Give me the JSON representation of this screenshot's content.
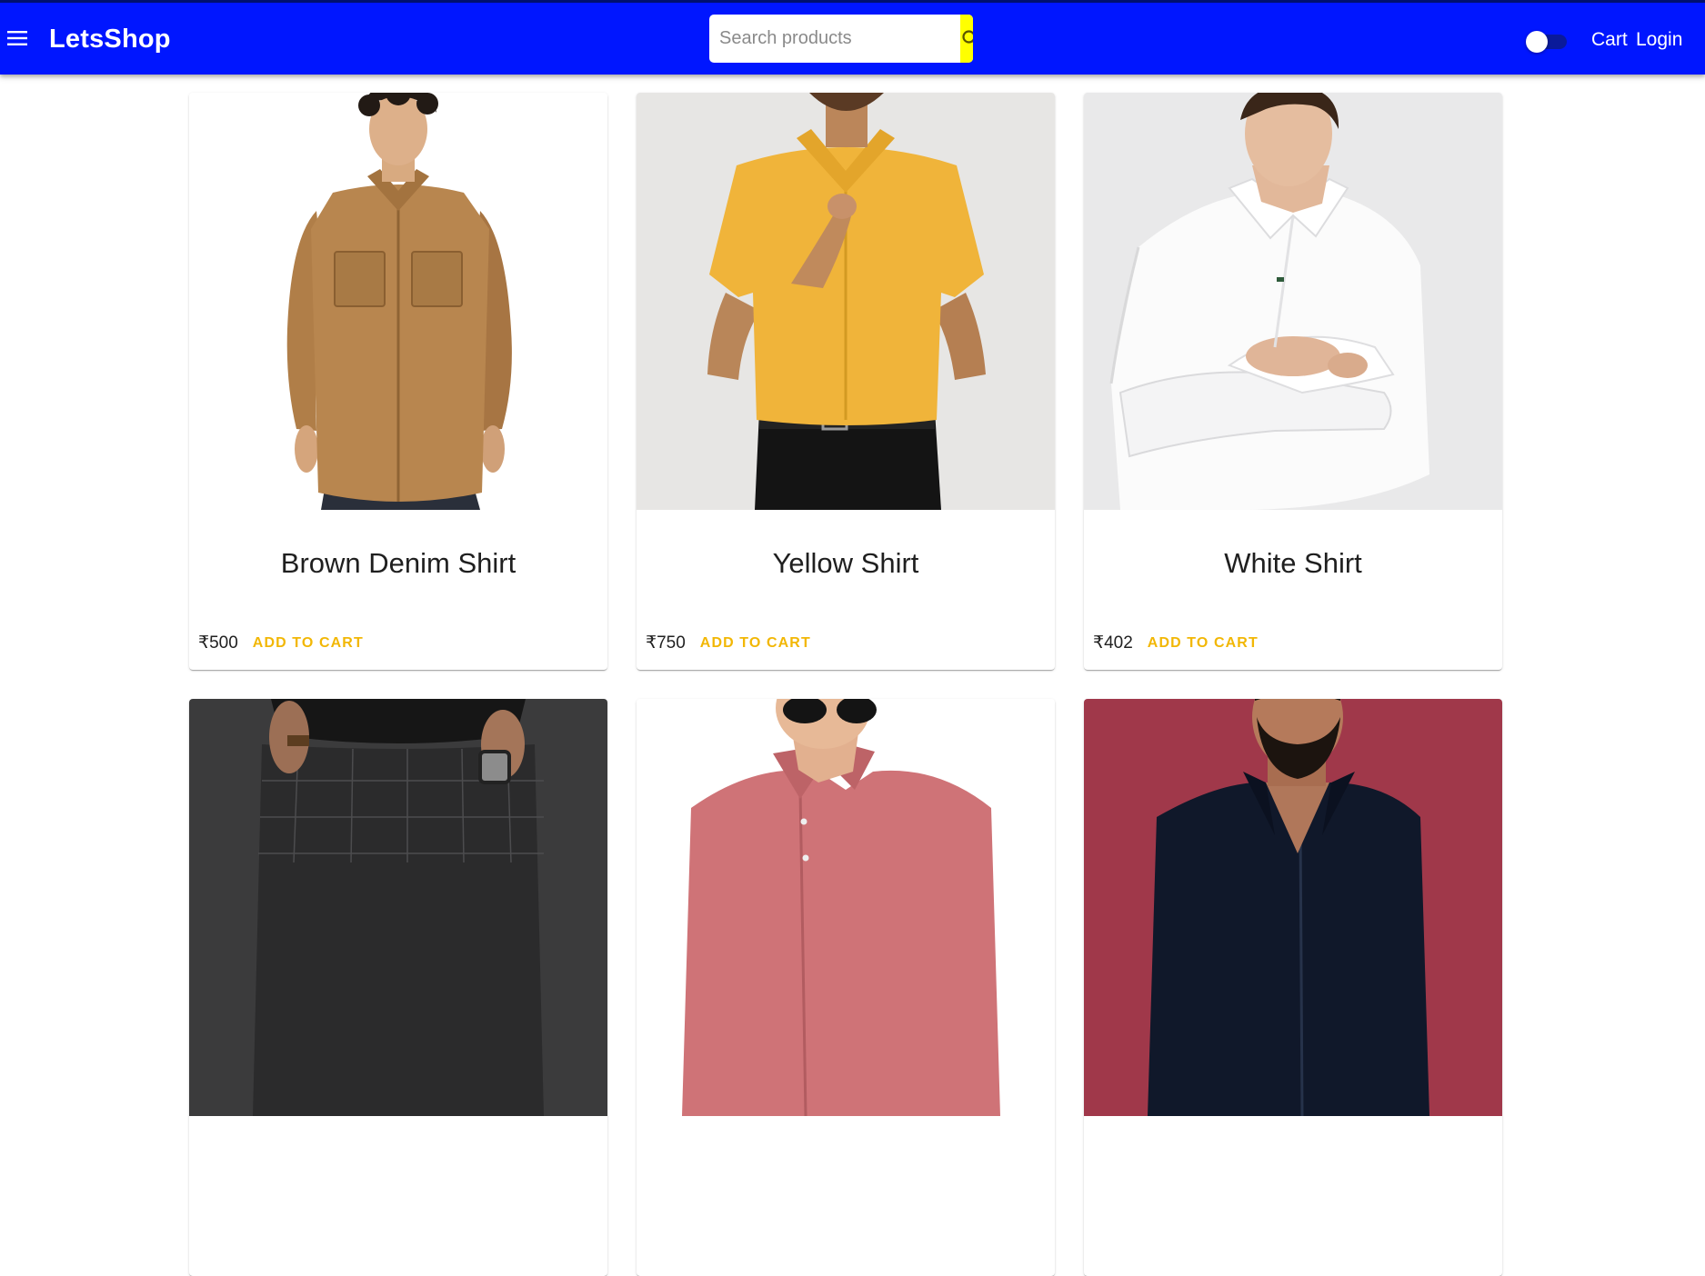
{
  "header": {
    "brand": "LetsShop",
    "menu_icon": "hamburger-menu-icon",
    "search": {
      "placeholder": "Search products",
      "value": "",
      "button_icon": "search-icon"
    },
    "theme_toggle": {
      "checked": false
    },
    "nav": {
      "cart_label": "Cart",
      "login_label": "Login"
    }
  },
  "colors": {
    "appbar": "#0016ff",
    "search_button": "#ffff00",
    "add_to_cart": "#f2b705"
  },
  "products": [
    {
      "title": "Brown Denim Shirt",
      "price": "₹500",
      "action_label": "ADD TO CART",
      "image": "man in brown denim shirt"
    },
    {
      "title": "Yellow Shirt",
      "price": "₹750",
      "action_label": "ADD TO CART",
      "image": "man in yellow shirt"
    },
    {
      "title": "White Shirt",
      "price": "₹402",
      "action_label": "ADD TO CART",
      "image": "man in white shirt"
    },
    {
      "title": "",
      "price": "",
      "action_label": "",
      "image": "man in checked trousers"
    },
    {
      "title": "",
      "price": "",
      "action_label": "",
      "image": "man in pink shirt with sunglasses"
    },
    {
      "title": "",
      "price": "",
      "action_label": "",
      "image": "man in black shirt"
    }
  ]
}
